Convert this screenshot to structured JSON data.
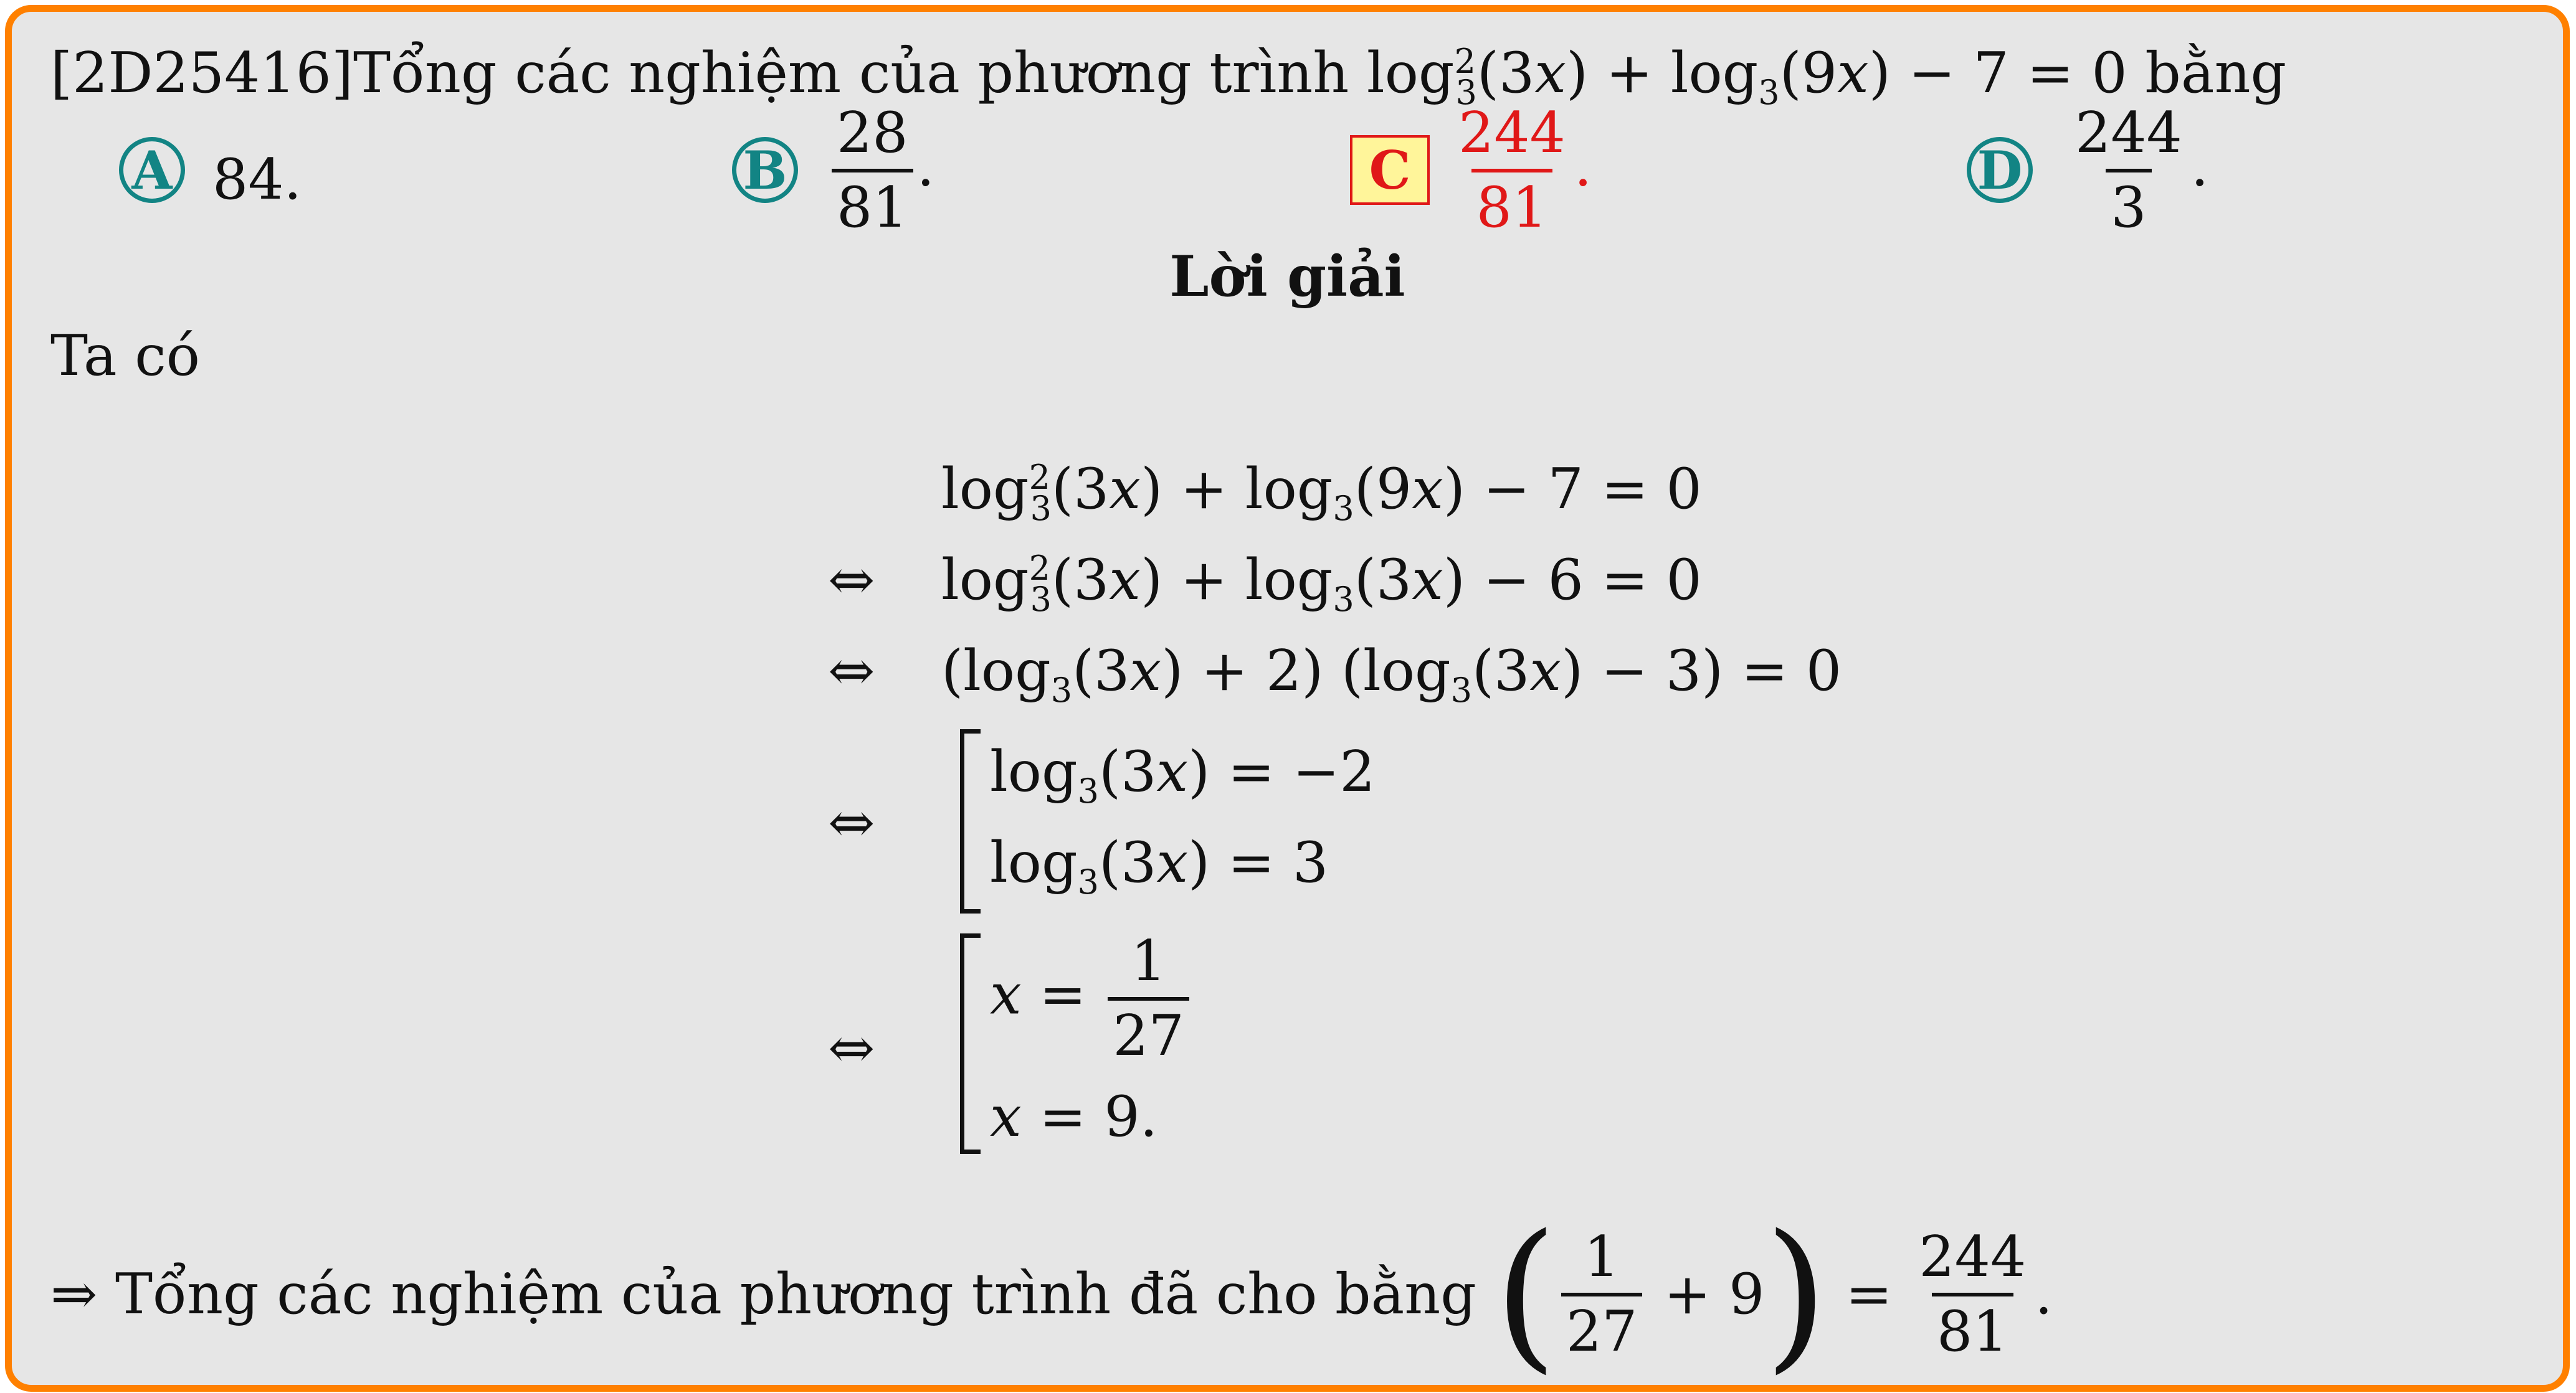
{
  "question": {
    "code": "[2D25416]",
    "prompt": "Tổng các nghiệm của phương trình",
    "equation": "log²₃(3x) + log₃(9x) − 7 = 0",
    "tail": "bằng"
  },
  "options": [
    {
      "letter": "A",
      "value": "84."
    },
    {
      "letter": "B",
      "numerator": "28",
      "denominator": "81",
      "suffix": "."
    },
    {
      "letter": "C",
      "numerator": "244",
      "denominator": "81",
      "suffix": ".",
      "correct": true
    },
    {
      "letter": "D",
      "numerator": "244",
      "denominator": "3",
      "suffix": "."
    }
  ],
  "solution": {
    "heading": "Lời giải",
    "intro": "Ta có",
    "steps": [
      "log²₃(3x) + log₃(9x) − 7 = 0",
      "log²₃(3x) + log₃(3x) − 6 = 0",
      "(log₃(3x) + 2)(log₃(3x) − 3) = 0",
      "log₃(3x) = −2 ; log₃(3x) = 3",
      "x = 1/27 ; x = 9."
    ],
    "conclusion_text": "Tổng các nghiệm của phương trình đã cho bằng",
    "conclusion_value": "244/81"
  },
  "colors": {
    "border": "#ff8000",
    "option_circle": "#128484",
    "correct": "#e01818",
    "highlight": "#fff59a"
  }
}
